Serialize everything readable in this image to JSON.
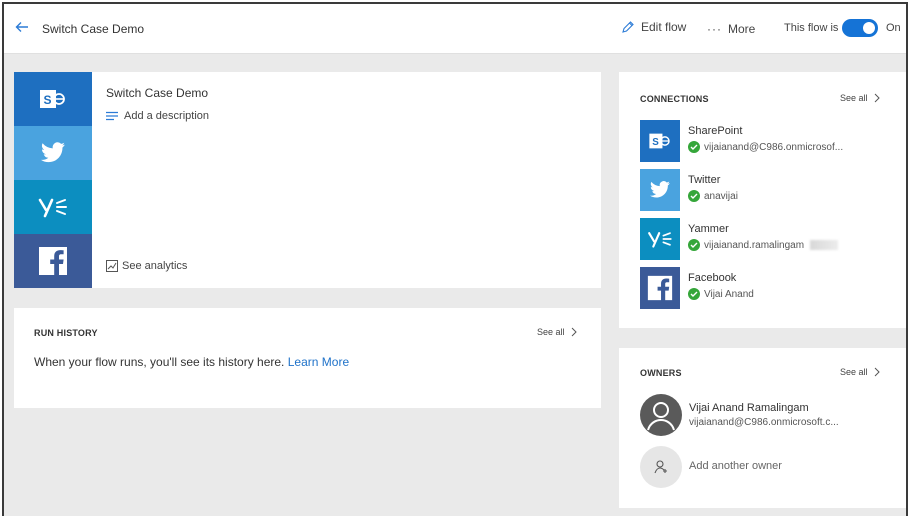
{
  "header": {
    "back_icon": "back-arrow-icon",
    "title": "Switch Case Demo",
    "edit_flow_label": "Edit flow",
    "more_label": "More",
    "flow_status_label": "This flow is",
    "toggle_state": "On",
    "accent_color": "#1573d6"
  },
  "flow_card": {
    "name": "Switch Case Demo",
    "add_description_label": "Add a description",
    "see_analytics_label": "See analytics",
    "tiles": [
      {
        "service": "SharePoint",
        "icon": "sharepoint-icon",
        "color": "#1e6fc0"
      },
      {
        "service": "Twitter",
        "icon": "twitter-icon",
        "color": "#4aa3df"
      },
      {
        "service": "Yammer",
        "icon": "yammer-icon",
        "color": "#0c8ec0"
      },
      {
        "service": "Facebook",
        "icon": "facebook-icon",
        "color": "#3b5a98"
      }
    ]
  },
  "run_history": {
    "heading": "RUN HISTORY",
    "see_all_label": "See all",
    "message": "When your flow runs, you'll see its history here.",
    "learn_more_label": "Learn More"
  },
  "connections": {
    "heading": "CONNECTIONS",
    "see_all_label": "See all",
    "items": [
      {
        "name": "SharePoint",
        "account": "vijaianand@C986.onmicrosof..."
      },
      {
        "name": "Twitter",
        "account": "anavijai"
      },
      {
        "name": "Yammer",
        "account": "vijaianand.ramalingam"
      },
      {
        "name": "Facebook",
        "account": "Vijai Anand"
      }
    ]
  },
  "owners": {
    "heading": "OWNERS",
    "see_all_label": "See all",
    "items": [
      {
        "name": "Vijai Anand Ramalingam",
        "email": "vijaianand@C986.onmicrosoft.c..."
      }
    ],
    "add_owner_label": "Add another owner"
  }
}
